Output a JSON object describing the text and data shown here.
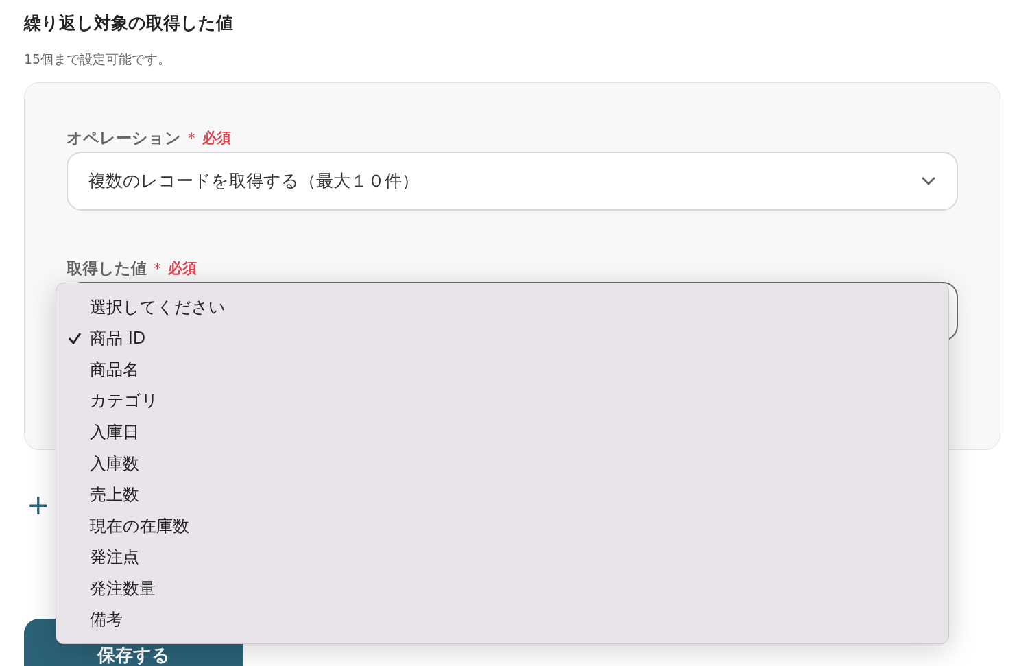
{
  "section": {
    "title": "繰り返し対象の取得した値",
    "note": "15個まで設定可能です。"
  },
  "card": {
    "fields": [
      {
        "label": "オペレーション",
        "required_mark": "＊",
        "required": "必須",
        "value": "複数のレコードを取得する（最大１０件）",
        "focused": false
      },
      {
        "label": "取得した値",
        "required_mark": "＊",
        "required": "必須",
        "focused": true
      }
    ]
  },
  "add_button": {
    "icon": "+"
  },
  "save_button": {
    "label": "保存する"
  },
  "dropdown_menu": {
    "items": [
      {
        "label": "選択してください",
        "selected": false
      },
      {
        "label": "商品 ID",
        "selected": true
      },
      {
        "label": "商品名",
        "selected": false
      },
      {
        "label": "カテゴリ",
        "selected": false
      },
      {
        "label": "入庫日",
        "selected": false
      },
      {
        "label": "入庫数",
        "selected": false
      },
      {
        "label": "売上数",
        "selected": false
      },
      {
        "label": "現在の在庫数",
        "selected": false
      },
      {
        "label": "発注点",
        "selected": false
      },
      {
        "label": "発注数量",
        "selected": false
      },
      {
        "label": "備考",
        "selected": false
      }
    ]
  }
}
